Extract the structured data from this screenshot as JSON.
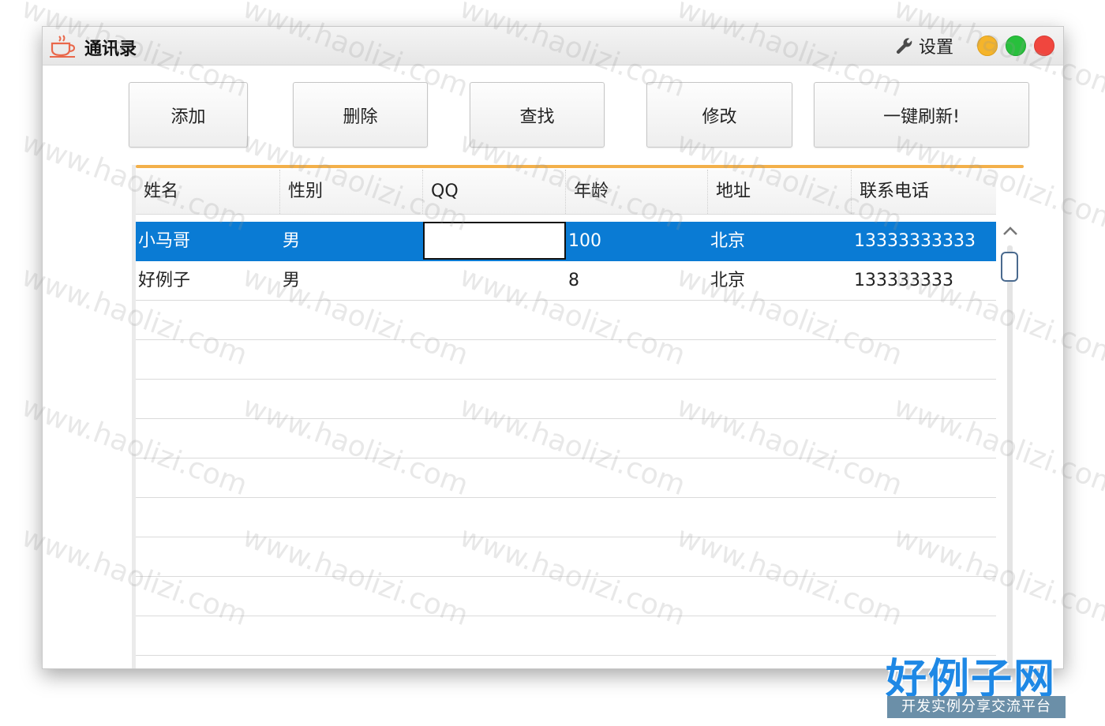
{
  "window": {
    "title": "通讯录",
    "settings_label": "设置"
  },
  "toolbar": {
    "add_label": "添加",
    "delete_label": "删除",
    "find_label": "查找",
    "edit_label": "修改",
    "refresh_label": "一键刷新!"
  },
  "table": {
    "columns": [
      "姓名",
      "性别",
      "QQ",
      "年龄",
      "地址",
      "联系电话"
    ],
    "rows": [
      {
        "name": "小马哥",
        "gender": "男",
        "qq": "",
        "age": "100",
        "address": "北京",
        "phone": "13333333333"
      },
      {
        "name": "好例子",
        "gender": "男",
        "qq": "",
        "age": "8",
        "address": "北京",
        "phone": "133333333"
      }
    ],
    "selected_row": 0
  },
  "watermark_text": "www.haolizi.com",
  "brand": {
    "name": "好例子网",
    "tagline": "开发实例分享交流平台"
  },
  "colors": {
    "selection": "#0a7bd4",
    "accent_line": "#f3b04a",
    "minimize": "#f5b42a",
    "maximize": "#28c03c",
    "close": "#f0463e",
    "brand_blue": "#1e88e5"
  }
}
